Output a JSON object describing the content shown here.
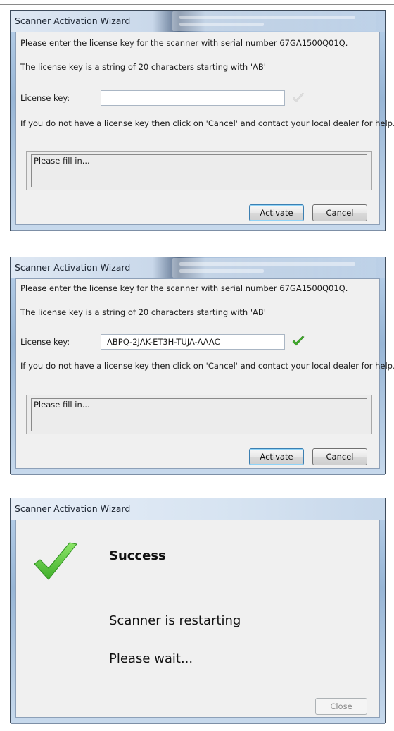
{
  "window_title": "Scanner Activation Wizard",
  "dialogs": [
    {
      "prompt": "Please enter the license key for the scanner with serial number 67GA1500Q01Q.",
      "format_hint": "The license key is a string of 20 characters starting with 'AB'",
      "license_label": "License key:",
      "license_value": "",
      "help_text": "If you do not have a license key then click on 'Cancel' and contact your local dealer for help.",
      "status_text": "Please fill in...",
      "activate_label": "Activate",
      "cancel_label": "Cancel",
      "key_valid": false
    },
    {
      "prompt": "Please enter the license key for the scanner with serial number 67GA1500Q01Q.",
      "format_hint": "The license key is a string of 20 characters starting with 'AB'",
      "license_label": "License key:",
      "license_value": "ABPQ-2JAK-ET3H-TUJA-AAAC",
      "help_text": "If you do not have a license key then click on 'Cancel' and contact your local dealer for help.",
      "status_text": "Please fill in...",
      "activate_label": "Activate",
      "cancel_label": "Cancel",
      "key_valid": true
    }
  ],
  "success": {
    "heading": "Success",
    "message": "Scanner is restarting",
    "wait": "Please wait...",
    "close_label": "Close",
    "check_color": "#5cc83a"
  },
  "colors": {
    "valid_check": "#3fae2a",
    "invalid_check": "#d6d6d6",
    "default_button_border": "#3c7fb1"
  }
}
